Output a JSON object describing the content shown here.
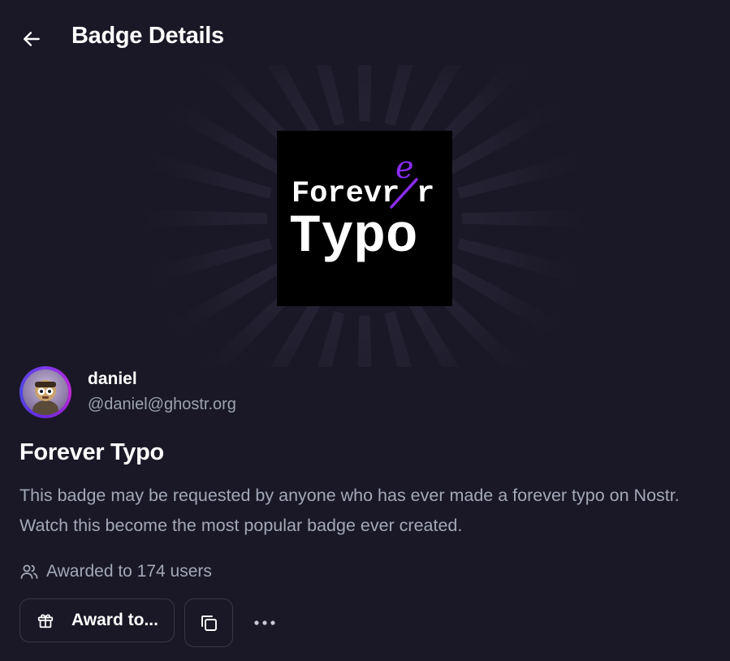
{
  "header": {
    "back_icon": "arrow-left-icon",
    "title": "Badge Details"
  },
  "badge": {
    "image_text_line1": "Forev",
    "image_text_struck": "r",
    "image_text_correction": "e",
    "image_text_line1_end": "r",
    "image_text_line2": "Typo",
    "name": "Forever Typo",
    "description": "This badge may be requested by anyone who has ever made a forever typo on Nostr. Watch this become the most popular badge ever created.",
    "awarded_text": "Awarded to 174 users",
    "awarded_count": 174
  },
  "author": {
    "name": "daniel",
    "handle": "@daniel@ghostr.org"
  },
  "actions": {
    "award_label": "Award to...",
    "award_icon": "gift-icon",
    "copy_icon": "copy-icon",
    "more_icon": "more-horizontal-icon"
  },
  "colors": {
    "background": "#1a1826",
    "accent_purple": "#8b2cf5",
    "muted_text": "#a3a8b8"
  }
}
